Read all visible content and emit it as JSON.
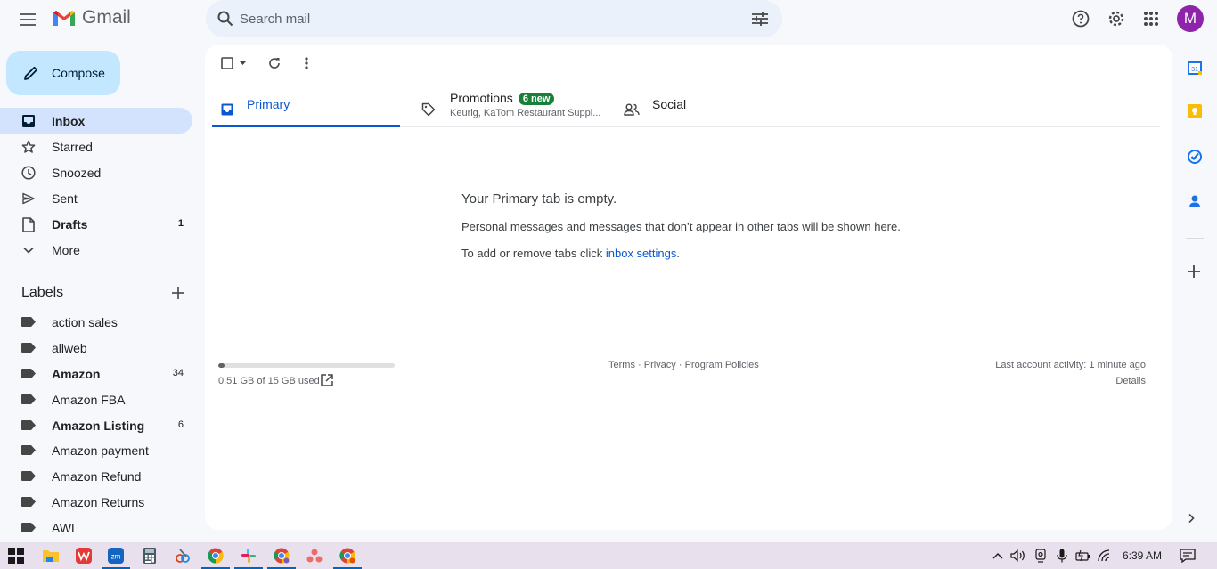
{
  "header": {
    "app_name": "Gmail",
    "search_placeholder": "Search mail",
    "avatar_initial": "M",
    "brand_colors": {
      "red": "#ea4335",
      "blue": "#4285f4",
      "green": "#34a853",
      "yellow": "#fbbc04",
      "avatar": "#8e24aa"
    }
  },
  "compose": {
    "label": "Compose"
  },
  "nav": [
    {
      "label": "Inbox",
      "icon": "inbox-icon",
      "active": true,
      "bold": true,
      "count": ""
    },
    {
      "label": "Starred",
      "icon": "star-icon",
      "count": ""
    },
    {
      "label": "Snoozed",
      "icon": "clock-icon",
      "count": ""
    },
    {
      "label": "Sent",
      "icon": "send-icon",
      "count": ""
    },
    {
      "label": "Drafts",
      "icon": "draft-icon",
      "bold": true,
      "count": "1"
    },
    {
      "label": "More",
      "icon": "chevron-down-icon",
      "count": ""
    }
  ],
  "labels": {
    "title": "Labels",
    "items": [
      {
        "label": "action sales",
        "count": ""
      },
      {
        "label": "allweb",
        "count": ""
      },
      {
        "label": "Amazon",
        "count": "34",
        "bold": true
      },
      {
        "label": "Amazon FBA",
        "count": ""
      },
      {
        "label": "Amazon Listing",
        "count": "6",
        "bold": true
      },
      {
        "label": "Amazon payment",
        "count": ""
      },
      {
        "label": "Amazon Refund",
        "count": ""
      },
      {
        "label": "Amazon Returns",
        "count": ""
      },
      {
        "label": "AWL",
        "count": ""
      }
    ]
  },
  "tabs": [
    {
      "label": "Primary",
      "active": true
    },
    {
      "label": "Promotions",
      "badge": "6 new",
      "subtitle": "Keurig, KaTom Restaurant Suppl..."
    },
    {
      "label": "Social"
    }
  ],
  "empty_state": {
    "title": "Your Primary tab is empty.",
    "description": "Personal messages and messages that don’t appear in other tabs will be shown here.",
    "settings_prefix": "To add or remove tabs click ",
    "settings_link": "inbox settings",
    "settings_suffix": "."
  },
  "footer": {
    "storage_text": "0.51 GB of 15 GB used",
    "storage_fraction": 0.034,
    "terms": "Terms",
    "privacy": "Privacy",
    "program_policies": "Program Policies",
    "separator": " · ",
    "last_activity": "Last account activity: 1 minute ago",
    "details": "Details"
  },
  "taskbar": {
    "time": "6:39 AM"
  }
}
